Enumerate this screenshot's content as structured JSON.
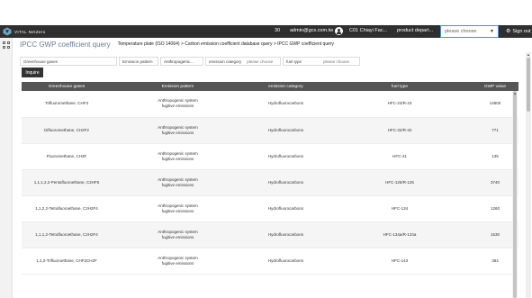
{
  "topbar": {
    "logo_text": "VITAL NetZero",
    "count": "30",
    "user": "admin@gcs.com.tw",
    "factory": "C01 Chiayi Fac...",
    "department": "product depart...",
    "select_placeholder": "please choose",
    "signout_label": "Sign out"
  },
  "page": {
    "title": "IPCC GWP coefficient query",
    "breadcrumb": "Temperature plate (ISO 14064) > Carbon emission coefficient database query > IPCC GWP coefficient query"
  },
  "filters": {
    "greenhouse_gases_label": "Greenhouse gases",
    "emission_pattern_label": "Emission pattern",
    "emission_pattern_value": "Anthropogenic...",
    "emission_category_label": "emission category",
    "emission_category_value": "please choose",
    "fuel_type_label": "fuel type",
    "fuel_type_value": "please choose"
  },
  "inquire_label": "Inquire",
  "table": {
    "headers": [
      "Greenhouse gases",
      "Emission pattern",
      "emission category",
      "fuel type",
      "GWP value"
    ],
    "rows": [
      {
        "gas": "Trifluoromethane, CHF3",
        "pattern": "Anthropogenic system fugitive emissions",
        "category": "Hydrofluorocarbons",
        "fuel": "HFC-23/R-23",
        "gwp": "14800"
      },
      {
        "gas": "Difluoromethane, CH2F2",
        "pattern": "Anthropogenic system fugitive emissions",
        "category": "Hydrofluorocarbons",
        "fuel": "HFC-32/R-32",
        "gwp": "771"
      },
      {
        "gas": "Fluoromethane, CH3F",
        "pattern": "Anthropogenic system fugitive emissions",
        "category": "Hydrofluorocarbons",
        "fuel": "HFC-41",
        "gwp": "135"
      },
      {
        "gas": "1,1,1,2,2-Pentafluoroethane, C2HF5",
        "pattern": "Anthropogenic system fugitive emissions",
        "category": "Hydrofluorocarbons",
        "fuel": "HFC-125/R-125",
        "gwp": "3740"
      },
      {
        "gas": "1,1,2,2-Tetrafluoroethane, C2H2F4",
        "pattern": "Anthropogenic system fugitive emissions",
        "category": "Hydrofluorocarbons",
        "fuel": "HFC-134",
        "gwp": "1260"
      },
      {
        "gas": "1,1,1,2-Tetrafluoroethane, C2H2F4",
        "pattern": "Anthropogenic system fugitive emissions",
        "category": "Hydrofluorocarbons",
        "fuel": "HFC-134a/R-134a",
        "gwp": "1530"
      },
      {
        "gas": "1,1,2-Trifluoroethane, CHF2CH2F",
        "pattern": "Anthropogenic system fugitive emissions",
        "category": "Hydrofluorocarbons",
        "fuel": "HFC-143",
        "gwp": "364"
      }
    ]
  },
  "icons": {
    "logo": "vital-logo-icon",
    "menu": "grid-menu-icon",
    "avatar": "user-avatar-icon",
    "dropdown": "chevron-down-icon",
    "signout": "gear-icon"
  }
}
